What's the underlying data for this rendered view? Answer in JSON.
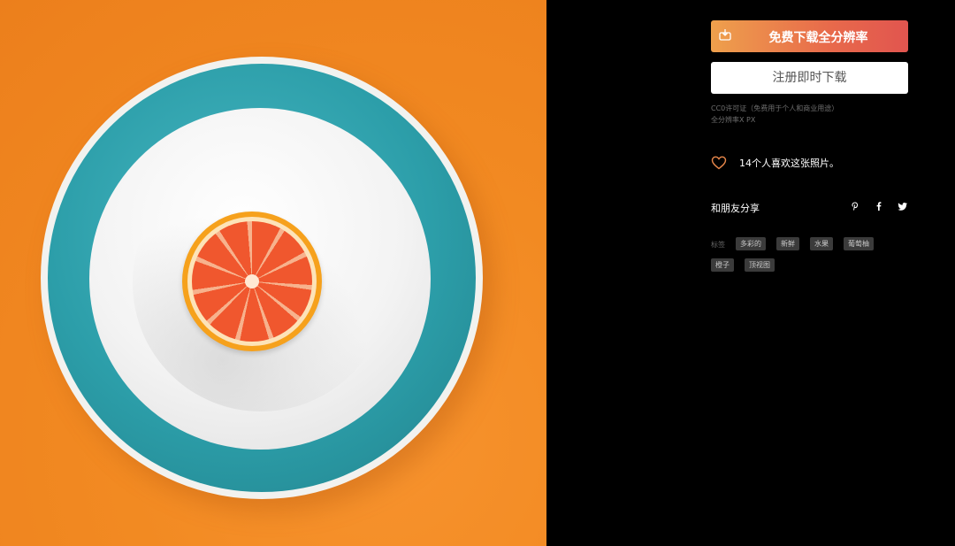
{
  "photo": {
    "subject": "halved-orange-on-plate",
    "colors": {
      "background": "#f28a22",
      "plate": "#2c9ea9",
      "bowl": "#f3f3f3",
      "orange_flesh": "#f0572e"
    }
  },
  "actions": {
    "free_download_label": "免费下载全分辨率",
    "register_download_label": "注册即时下载"
  },
  "license": {
    "line1": "CC0许可证（免费用于个人和商业用途）",
    "line2": "全分辨率X PX"
  },
  "likes": {
    "text": "14个人喜欢这张照片。"
  },
  "share": {
    "label": "和朋友分享",
    "icons": [
      "pinterest-icon",
      "facebook-icon",
      "twitter-icon"
    ]
  },
  "tags": {
    "label": "标签",
    "items": [
      "多彩的",
      "新鲜",
      "水果",
      "葡萄柚",
      "橙子",
      "顶视图"
    ]
  },
  "colors": {
    "accent_gradient_start": "#eea04c",
    "accent_gradient_end": "#e1554f",
    "heart": "#e8874a"
  }
}
